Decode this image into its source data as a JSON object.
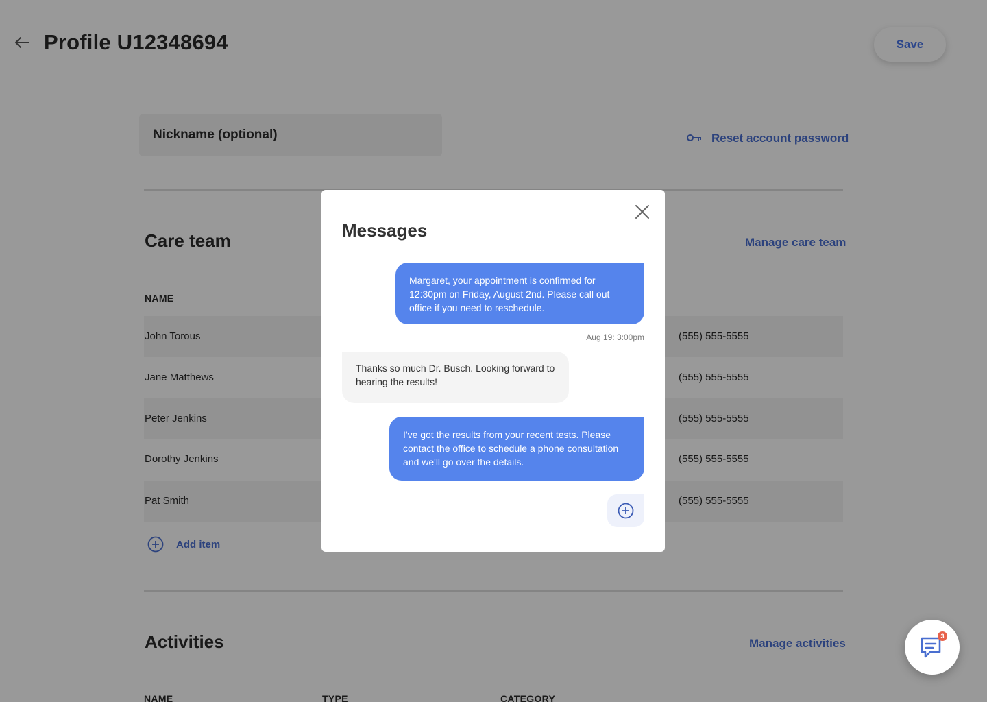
{
  "header": {
    "title": "Profile U12348694",
    "save_label": "Save"
  },
  "profile": {
    "nickname_placeholder": "Nickname (optional)",
    "reset_password_label": "Reset account password"
  },
  "care_team": {
    "title": "Care team",
    "manage_label": "Manage care team",
    "columns": [
      "NAME"
    ],
    "rows": [
      {
        "name": "John Torous",
        "phone": "(555) 555-5555"
      },
      {
        "name": "Jane Matthews",
        "phone": "(555) 555-5555"
      },
      {
        "name": "Peter Jenkins",
        "phone": "(555) 555-5555"
      },
      {
        "name": "Dorothy Jenkins",
        "phone": "(555) 555-5555"
      },
      {
        "name": "Pat Smith",
        "phone": "(555) 555-5555"
      }
    ],
    "add_item_label": "Add item"
  },
  "activities": {
    "title": "Activities",
    "manage_label": "Manage activities",
    "columns": [
      "NAME",
      "TYPE",
      "CATEGORY"
    ]
  },
  "chat_fab": {
    "badge_count": "3"
  },
  "messages_modal": {
    "title": "Messages",
    "messages": [
      {
        "direction": "out",
        "text": "Margaret, your appointment is confirmed for 12:30pm on Friday, August 2nd. Please call out office if you need to reschedule."
      },
      {
        "direction": "in",
        "text": "Thanks so much Dr. Busch. Looking forward to hearing the results!"
      },
      {
        "direction": "out",
        "text": "I've got the results from your recent tests. Please contact the office to schedule a phone consultation and we'll go over the details."
      }
    ],
    "first_timestamp": "Aug 19: 3:00pm"
  },
  "colors": {
    "accent": "#4a6fd0",
    "bubble_out": "#5584ec",
    "badge": "#e8614a"
  }
}
